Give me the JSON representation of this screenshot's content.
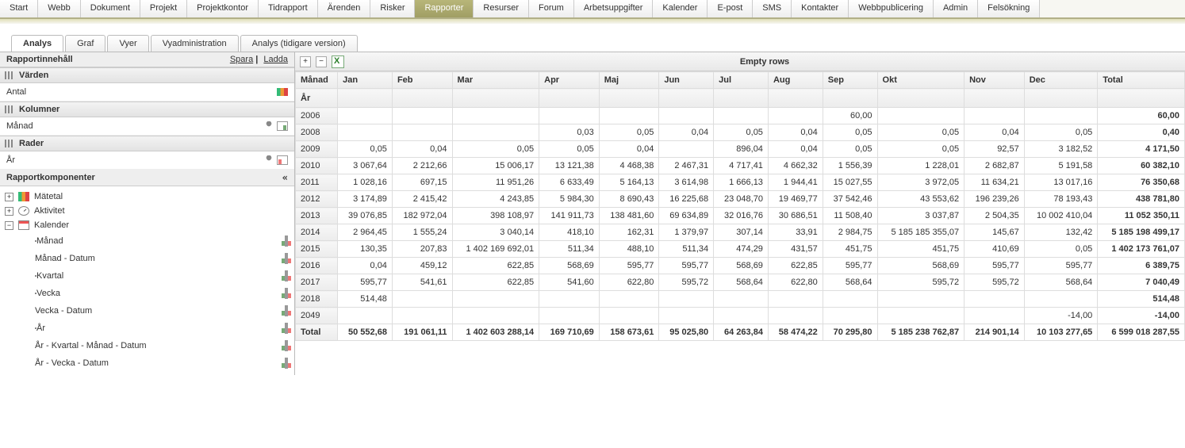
{
  "topnav": [
    "Start",
    "Webb",
    "Dokument",
    "Projekt",
    "Projektkontor",
    "Tidrapport",
    "Ärenden",
    "Risker",
    "Rapporter",
    "Resurser",
    "Forum",
    "Arbetsuppgifter",
    "Kalender",
    "E-post",
    "SMS",
    "Kontakter",
    "Webbpublicering",
    "Admin",
    "Felsökning"
  ],
  "topnav_active": 8,
  "subtabs": [
    "Analys",
    "Graf",
    "Vyer",
    "Vyadministration",
    "Analys (tidigare version)"
  ],
  "subtabs_active": 0,
  "left": {
    "header": "Rapportinnehåll",
    "save": "Spara",
    "load": "Ladda",
    "values_section": "Värden",
    "values_item": "Antal",
    "columns_section": "Kolumner",
    "columns_item": "Månad",
    "rows_section": "Rader",
    "rows_item": "År",
    "components_header": "Rapportkomponenter",
    "tree": {
      "metric": "Mätetal",
      "activity": "Aktivitet",
      "calendar": "Kalender",
      "children": [
        "Månad",
        "Månad - Datum",
        "Kvartal",
        "Vecka",
        "Vecka - Datum",
        "År",
        "År - Kvartal - Månad - Datum",
        "År - Vecka - Datum"
      ],
      "child_is_hier": [
        false,
        true,
        false,
        false,
        true,
        false,
        true,
        true
      ]
    }
  },
  "grid": {
    "toolbar_title": "Empty rows",
    "header_top": "Månad",
    "header_left": "År",
    "months": [
      "Jan",
      "Feb",
      "Mar",
      "Apr",
      "Maj",
      "Jun",
      "Jul",
      "Aug",
      "Sep",
      "Okt",
      "Nov",
      "Dec"
    ],
    "total_label": "Total",
    "rows": [
      {
        "y": "2006",
        "c": [
          "",
          "",
          "",
          "",
          "",
          "",
          "",
          "",
          "60,00",
          "",
          "",
          ""
        ],
        "t": "60,00"
      },
      {
        "y": "2008",
        "c": [
          "",
          "",
          "",
          "0,03",
          "0,05",
          "0,04",
          "0,05",
          "0,04",
          "0,05",
          "0,05",
          "0,04",
          "0,05"
        ],
        "t": "0,40"
      },
      {
        "y": "2009",
        "c": [
          "0,05",
          "0,04",
          "0,05",
          "0,05",
          "0,04",
          "",
          "896,04",
          "0,04",
          "0,05",
          "0,05",
          "92,57",
          "3 182,52"
        ],
        "t": "4 171,50"
      },
      {
        "y": "2010",
        "c": [
          "3 067,64",
          "2 212,66",
          "15 006,17",
          "13 121,38",
          "4 468,38",
          "2 467,31",
          "4 717,41",
          "4 662,32",
          "1 556,39",
          "1 228,01",
          "2 682,87",
          "5 191,58"
        ],
        "t": "60 382,10"
      },
      {
        "y": "2011",
        "c": [
          "1 028,16",
          "697,15",
          "11 951,26",
          "6 633,49",
          "5 164,13",
          "3 614,98",
          "1 666,13",
          "1 944,41",
          "15 027,55",
          "3 972,05",
          "11 634,21",
          "13 017,16"
        ],
        "t": "76 350,68"
      },
      {
        "y": "2012",
        "c": [
          "3 174,89",
          "2 415,42",
          "4 243,85",
          "5 984,30",
          "8 690,43",
          "16 225,68",
          "23 048,70",
          "19 469,77",
          "37 542,46",
          "43 553,62",
          "196 239,26",
          "78 193,43"
        ],
        "t": "438 781,80"
      },
      {
        "y": "2013",
        "c": [
          "39 076,85",
          "182 972,04",
          "398 108,97",
          "141 911,73",
          "138 481,60",
          "69 634,89",
          "32 016,76",
          "30 686,51",
          "11 508,40",
          "3 037,87",
          "2 504,35",
          "10 002 410,04"
        ],
        "t": "11 052 350,11"
      },
      {
        "y": "2014",
        "c": [
          "2 964,45",
          "1 555,24",
          "3 040,14",
          "418,10",
          "162,31",
          "1 379,97",
          "307,14",
          "33,91",
          "2 984,75",
          "5 185 185 355,07",
          "145,67",
          "132,42"
        ],
        "t": "5 185 198 499,17"
      },
      {
        "y": "2015",
        "c": [
          "130,35",
          "207,83",
          "1 402 169 692,01",
          "511,34",
          "488,10",
          "511,34",
          "474,29",
          "431,57",
          "451,75",
          "451,75",
          "410,69",
          "0,05"
        ],
        "t": "1 402 173 761,07"
      },
      {
        "y": "2016",
        "c": [
          "0,04",
          "459,12",
          "622,85",
          "568,69",
          "595,77",
          "595,77",
          "568,69",
          "622,85",
          "595,77",
          "568,69",
          "595,77",
          "595,77"
        ],
        "t": "6 389,75"
      },
      {
        "y": "2017",
        "c": [
          "595,77",
          "541,61",
          "622,85",
          "541,60",
          "622,80",
          "595,72",
          "568,64",
          "622,80",
          "568,64",
          "595,72",
          "595,72",
          "568,64"
        ],
        "t": "7 040,49"
      },
      {
        "y": "2018",
        "c": [
          "514,48",
          "",
          "",
          "",
          "",
          "",
          "",
          "",
          "",
          "",
          "",
          ""
        ],
        "t": "514,48"
      },
      {
        "y": "2049",
        "c": [
          "",
          "",
          "",
          "",
          "",
          "",
          "",
          "",
          "",
          "",
          "",
          "-14,00"
        ],
        "t": "-14,00"
      }
    ],
    "totals": {
      "y": "Total",
      "c": [
        "50 552,68",
        "191 061,11",
        "1 402 603 288,14",
        "169 710,69",
        "158 673,61",
        "95 025,80",
        "64 263,84",
        "58 474,22",
        "70 295,80",
        "5 185 238 762,87",
        "214 901,14",
        "10 103 277,65"
      ],
      "t": "6 599 018 287,55"
    }
  }
}
